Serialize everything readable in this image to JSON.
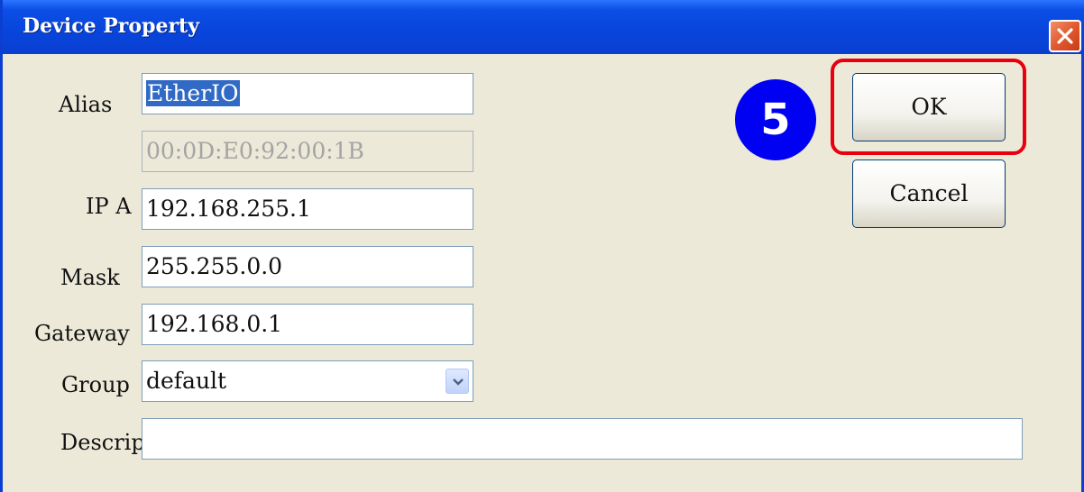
{
  "window": {
    "title": "Device Property",
    "close_icon": "close-x-icon",
    "accent": "#0a3fd1"
  },
  "form": {
    "alias": {
      "label": "Alias",
      "value": "EtherIO"
    },
    "mac": {
      "value": "00:0D:E0:92:00:1B"
    },
    "ip": {
      "label": "IP A",
      "value": "192.168.255.1"
    },
    "mask": {
      "label": "Mask",
      "value": "255.255.0.0"
    },
    "gateway": {
      "label": "Gateway",
      "value": "192.168.0.1"
    },
    "group": {
      "label": "Group",
      "value": "default",
      "arrow_icon": "chevron-down-icon"
    },
    "description": {
      "label": "Descrip",
      "value": ""
    }
  },
  "buttons": {
    "ok": "OK",
    "cancel": "Cancel"
  },
  "annotation": {
    "step_number": "5",
    "highlight_color": "#e8000f",
    "badge_color": "#0000f2"
  }
}
